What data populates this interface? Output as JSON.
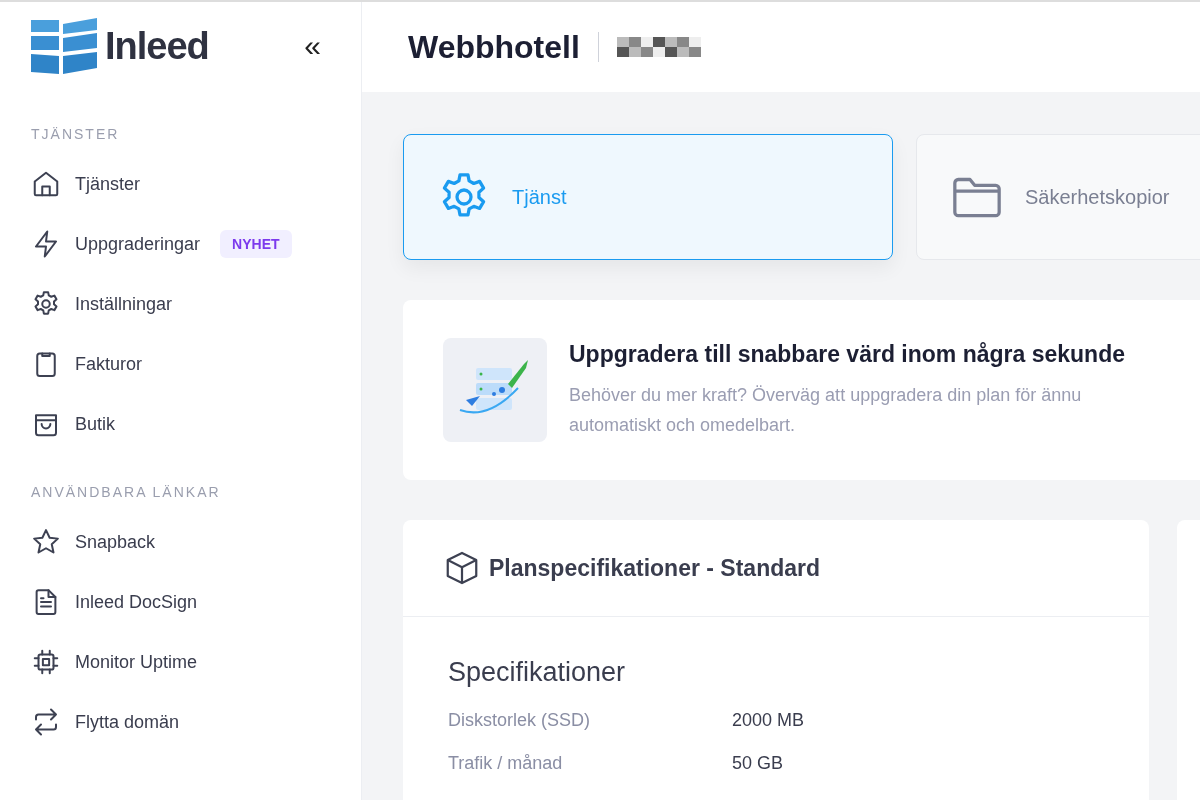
{
  "sidebar": {
    "logo_text": "Inleed",
    "collapse": "«",
    "sections": [
      {
        "title": "TJÄNSTER",
        "items": [
          {
            "label": "Tjänster"
          },
          {
            "label": "Uppgraderingar",
            "badge": "NYHET"
          },
          {
            "label": "Inställningar"
          },
          {
            "label": "Fakturor"
          },
          {
            "label": "Butik"
          }
        ]
      },
      {
        "title": "ANVÄNDBARA LÄNKAR",
        "items": [
          {
            "label": "Snapback"
          },
          {
            "label": "Inleed DocSign"
          },
          {
            "label": "Monitor Uptime"
          },
          {
            "label": "Flytta domän"
          }
        ]
      }
    ]
  },
  "header": {
    "title": "Webbhotell"
  },
  "tabs": [
    {
      "label": "Tjänst",
      "selected": true
    },
    {
      "label": "Säkerhetskopior",
      "selected": false
    }
  ],
  "banner": {
    "title": "Uppgradera till snabbare värd inom några sekunde",
    "text": "Behöver du mer kraft? Överväg att uppgradera din plan för ännu",
    "text_line_2": "automatiskt och omedelbart."
  },
  "plan": {
    "title": "Planspecifikationer - Standard",
    "section": "Specifikationer",
    "rows": [
      {
        "label": "Diskstorlek (SSD)",
        "value": "2000 MB"
      },
      {
        "label": "Trafik / månad",
        "value": "50 GB"
      }
    ]
  }
}
